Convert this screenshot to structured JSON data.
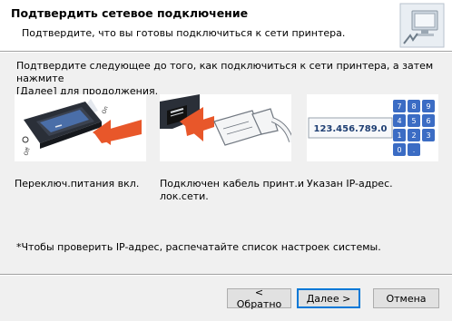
{
  "header": {
    "title": "Подтвердить сетевое подключение",
    "subtitle": "Подтвердите, что вы готовы подключиться к сети принтера.",
    "icon": "network-computer-icon"
  },
  "intro": {
    "line1": "Подтвердите следующее до того, как подключиться к сети принтера, а затем нажмите",
    "line2": "[Далее] для продолжения."
  },
  "steps": [
    {
      "icon": "power-switch-icon",
      "caption": "Переключ.питания вкл.",
      "switch_on_label": "On",
      "switch_off_label": "Off"
    },
    {
      "icon": "network-cable-icon",
      "caption_line1": "Подключен кабель принт.и",
      "caption_line2": "лок.сети."
    },
    {
      "icon": "ip-keypad-icon",
      "caption": "Указан IP-адрес.",
      "ip_text": "123.456.789.0",
      "keys": [
        "7",
        "8",
        "9",
        "4",
        "5",
        "6",
        "1",
        "2",
        "3",
        "0",
        "."
      ]
    }
  ],
  "note": "*Чтобы проверить IP-адрес, распечатайте список настроек системы.",
  "buttons": {
    "back": "< Обратно",
    "next": "Далее >",
    "cancel": "Отмена"
  },
  "colors": {
    "accent": "#0078d7",
    "arrow": "#e8572a",
    "keypad": "#3b6cc4"
  }
}
